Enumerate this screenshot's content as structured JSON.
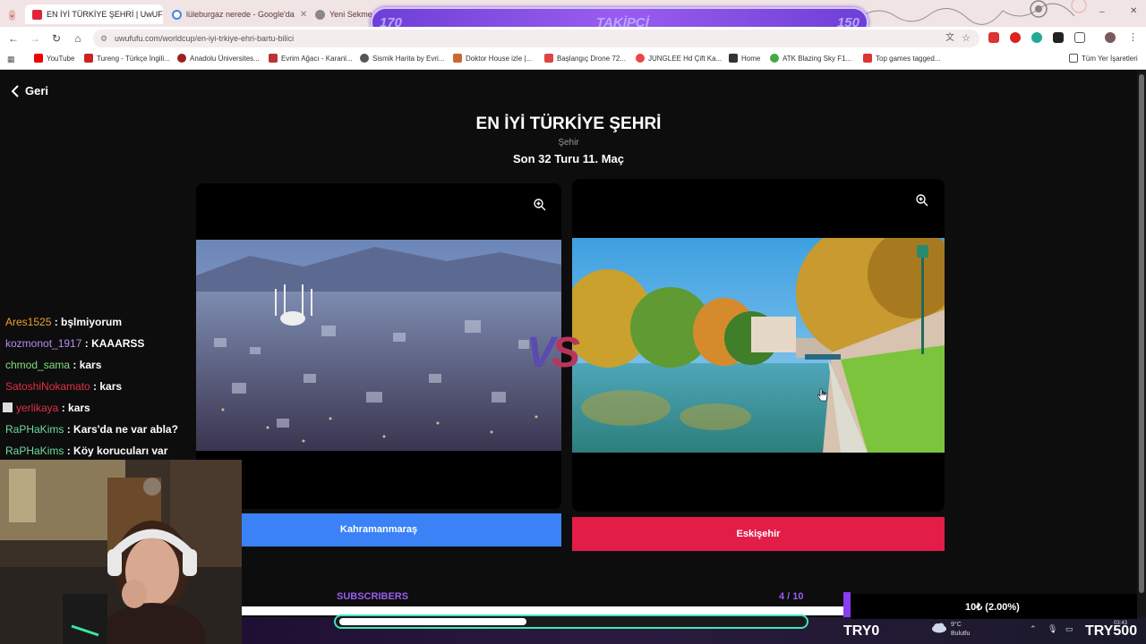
{
  "browser": {
    "tabs": [
      {
        "label": "EN İYİ TÜRKİYE ŞEHRİ | UwUFU",
        "active": true
      },
      {
        "label": "lüleburgaz nerede - Google'da",
        "active": false
      },
      {
        "label": "Yeni Sekme",
        "active": false
      }
    ],
    "url": "uwufufu.com/worldcup/en-iyi-trkiye-ehri-bartu-bilici",
    "bookmarks": [
      "YouTube",
      "Tureng - Türkçe İngili...",
      "Anadolu Üniversites...",
      "Evrim Ağacı - Karanl...",
      "Sismik Harita by Evri...",
      "Doktor House izle |...",
      "Başlangıç Drone 72...",
      "JUNGLEE Hd Çift Ka...",
      "Home",
      "ATK Blazing Sky F1...",
      "Top games tagged..."
    ],
    "all_bookmarks": "Tüm Yer İşaretleri"
  },
  "follower_goal": {
    "label": "TAKİPÇİ",
    "current": "170",
    "target": "150"
  },
  "page": {
    "back_label": "Geri",
    "title": "EN İYİ TÜRKİYE ŞEHRİ",
    "category": "Şehir",
    "round": "Son 32 Turu 11. Maç",
    "vs_label": "VS",
    "left": {
      "name": "Kahramanmaraş",
      "button_color": "#3b82f6"
    },
    "right": {
      "name": "Eskişehir",
      "button_color": "#e11d48"
    }
  },
  "chat": [
    {
      "user": "Ares1525",
      "color": "#f0a030",
      "message": ": bşlmiyorum"
    },
    {
      "user": "kozmonot_1917",
      "color": "#b98cf0",
      "message": ": KAAARSS"
    },
    {
      "user": "chmod_sama",
      "color": "#7fe07f",
      "message": ": kars"
    },
    {
      "user": "SatoshiNokamato",
      "color": "#e0304a",
      "message": ": kars"
    },
    {
      "user": "yerlikaya",
      "color": "#e0304a",
      "message": ": kars"
    },
    {
      "user": "RaPHaKims",
      "color": "#6fdc9c",
      "message": ": Kars'da ne var abla?"
    },
    {
      "user": "RaPHaKims",
      "color": "#6fdc9c",
      "message": ": Köy korucuları var"
    }
  ],
  "subscribers": {
    "label": "SUBSCRIBERS",
    "count": "4 / 10",
    "progress": 0.4
  },
  "donation": {
    "text": "10₺ (2.00%)",
    "left_label": "TRY0",
    "right_label": "TRY500",
    "progress": 0.4
  },
  "taskbar": {
    "temperature": "9°C",
    "weather": "Bulutlu",
    "time": "03:43"
  }
}
